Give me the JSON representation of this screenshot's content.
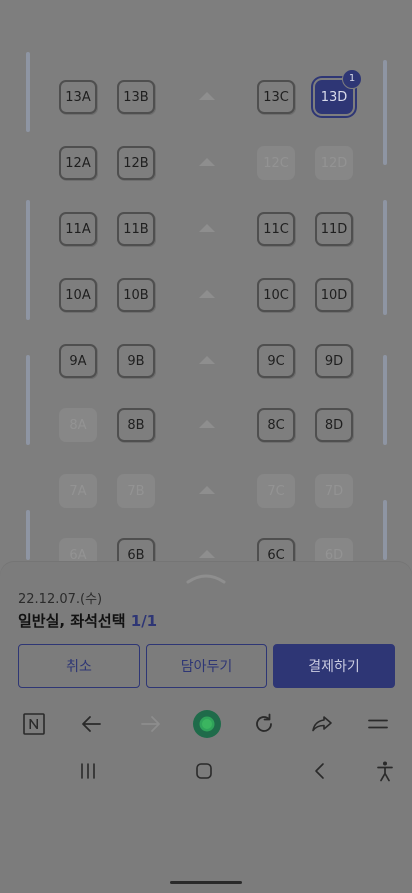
{
  "seat_rows": [
    [
      {
        "label": "13A",
        "state": "available"
      },
      {
        "label": "13B",
        "state": "available"
      },
      {
        "label": "13C",
        "state": "available"
      },
      {
        "label": "13D",
        "state": "selected",
        "badge": "1"
      }
    ],
    [
      {
        "label": "12A",
        "state": "available"
      },
      {
        "label": "12B",
        "state": "available"
      },
      {
        "label": "12C",
        "state": "disabled"
      },
      {
        "label": "12D",
        "state": "disabled"
      }
    ],
    [
      {
        "label": "11A",
        "state": "available"
      },
      {
        "label": "11B",
        "state": "available"
      },
      {
        "label": "11C",
        "state": "available"
      },
      {
        "label": "11D",
        "state": "available"
      }
    ],
    [
      {
        "label": "10A",
        "state": "available"
      },
      {
        "label": "10B",
        "state": "available"
      },
      {
        "label": "10C",
        "state": "available"
      },
      {
        "label": "10D",
        "state": "available"
      }
    ],
    [
      {
        "label": "9A",
        "state": "available"
      },
      {
        "label": "9B",
        "state": "available"
      },
      {
        "label": "9C",
        "state": "available"
      },
      {
        "label": "9D",
        "state": "available"
      }
    ],
    [
      {
        "label": "8A",
        "state": "disabled"
      },
      {
        "label": "8B",
        "state": "available"
      },
      {
        "label": "8C",
        "state": "available"
      },
      {
        "label": "8D",
        "state": "available"
      }
    ],
    [
      {
        "label": "7A",
        "state": "disabled"
      },
      {
        "label": "7B",
        "state": "disabled"
      },
      {
        "label": "7C",
        "state": "disabled"
      },
      {
        "label": "7D",
        "state": "disabled"
      }
    ],
    [
      {
        "label": "6A",
        "state": "disabled"
      },
      {
        "label": "6B",
        "state": "available"
      },
      {
        "label": "6C",
        "state": "available"
      },
      {
        "label": "6D",
        "state": "disabled"
      }
    ]
  ],
  "sheet": {
    "date": "22.12.07.(수)",
    "title": "일반실, 좌석선택",
    "count": "1/1",
    "cancel_label": "취소",
    "cart_label": "담아두기",
    "pay_label": "결제하기"
  },
  "browser_toolbar": {
    "icons": [
      "naver-n-icon",
      "back-arrow-icon",
      "forward-arrow-icon",
      "home-green-icon",
      "refresh-icon",
      "share-icon",
      "menu-icon"
    ]
  },
  "system_nav": {
    "icons": [
      "recent-apps-icon",
      "home-icon",
      "back-icon",
      "accessibility-icon"
    ]
  },
  "colors": {
    "accent": "#2e3675",
    "dim_overlay": "#7c7c7c",
    "seat_border": "#4f4f4f"
  }
}
